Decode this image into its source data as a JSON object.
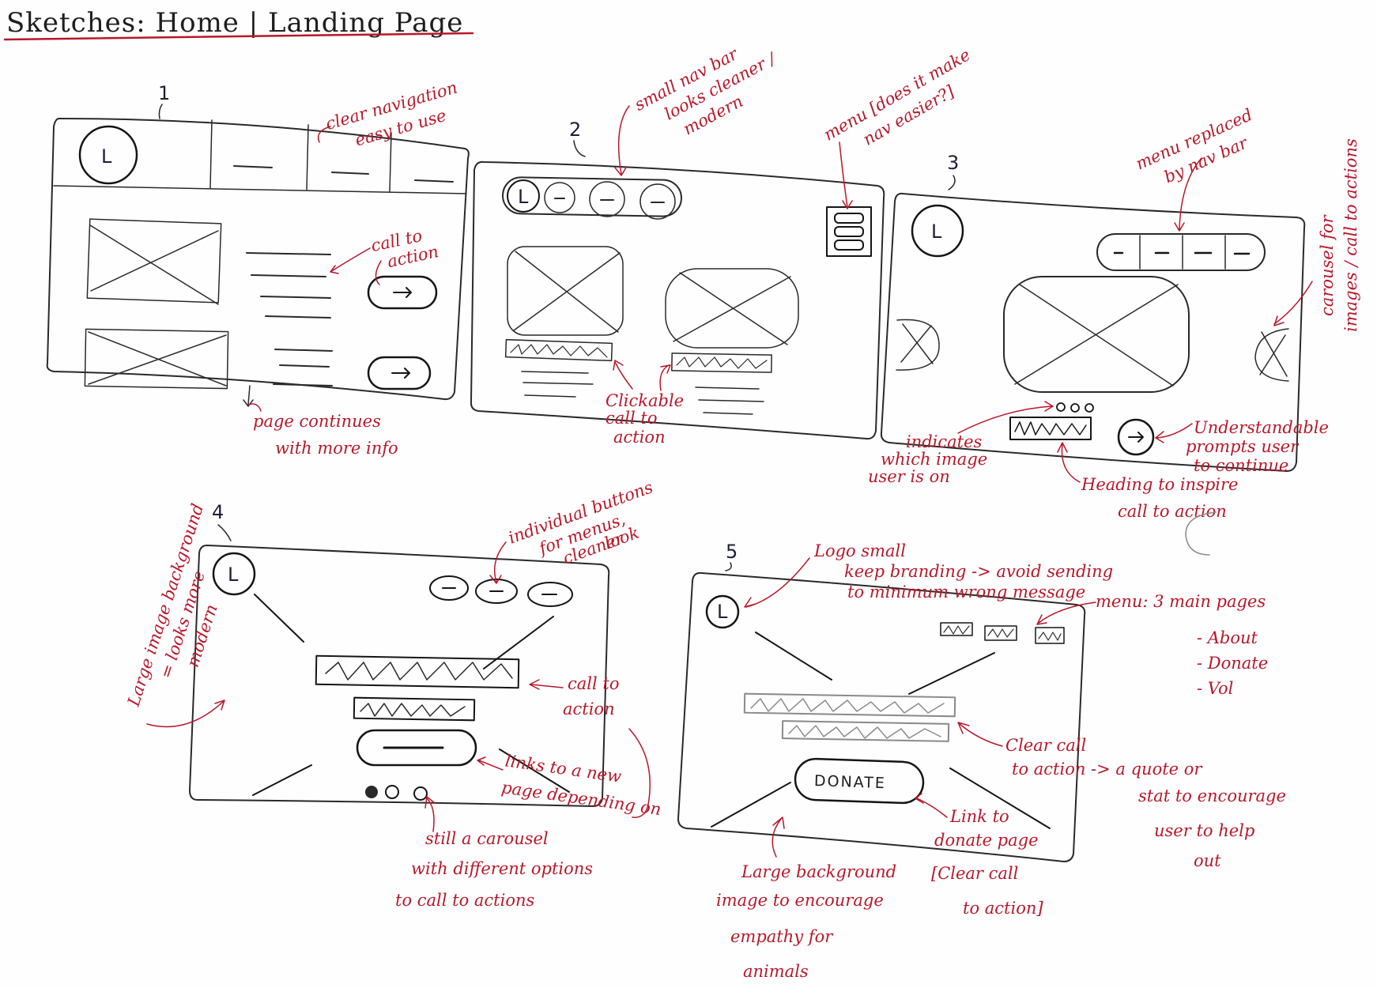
{
  "title": "Sketches: Home | Landing Page",
  "sketch_numbers": [
    "1",
    "2",
    "3",
    "4",
    "5"
  ],
  "logo_letter": "L",
  "donate_label": "DONATE",
  "annotations": {
    "s1_nav": [
      "clear navigation",
      "easy to use"
    ],
    "s1_cta": [
      "call to",
      "action"
    ],
    "s1_page": [
      "page continues",
      "with more info"
    ],
    "s2_nav": [
      "small nav bar",
      "looks cleaner /",
      "modern"
    ],
    "s2_menu": [
      "menu [does it make",
      "nav easier?]"
    ],
    "s2_cta": [
      "Clickable",
      "call to",
      "action"
    ],
    "s3_menu": [
      "menu replaced",
      "by nav bar"
    ],
    "s3_carousel": [
      "carousel for",
      "images / call to actions"
    ],
    "s3_indicates": [
      "indicates",
      "which image",
      "user is on"
    ],
    "s3_prompt": [
      "Understandable",
      "prompts user",
      "to continue"
    ],
    "s3_heading": [
      "Heading to inspire",
      "call to action"
    ],
    "s4_bg": [
      "Large image background",
      "= looks more",
      "modern"
    ],
    "s4_buttons": [
      "individual buttons",
      "for menus,",
      "cleaner",
      "look"
    ],
    "s4_cta": [
      "call to",
      "action"
    ],
    "s4_link": [
      "links to a new",
      "page depending on"
    ],
    "s4_carousel": [
      "still a carousel",
      "with different options",
      "to call to actions"
    ],
    "s5_logo": [
      "Logo small",
      "keep branding -> avoid sending",
      "to minimum         wrong message"
    ],
    "s5_menu": [
      "menu: 3 main pages",
      "- About",
      "- Donate",
      "- Vol"
    ],
    "s5_cta": [
      "Clear call",
      "to action -> a quote or"
    ],
    "s5_stat": [
      "stat to encourage",
      "user to help",
      "out"
    ],
    "s5_link": [
      "Link to",
      "donate page"
    ],
    "s5_clear": [
      "[Clear call",
      "to action]"
    ],
    "s5_bg": [
      "Large background",
      "image to encourage",
      "empathy for",
      "animals"
    ]
  },
  "colors": {
    "ink": "#2a2a2a",
    "annotation": "#b8182a",
    "paper": "#fefefe"
  }
}
